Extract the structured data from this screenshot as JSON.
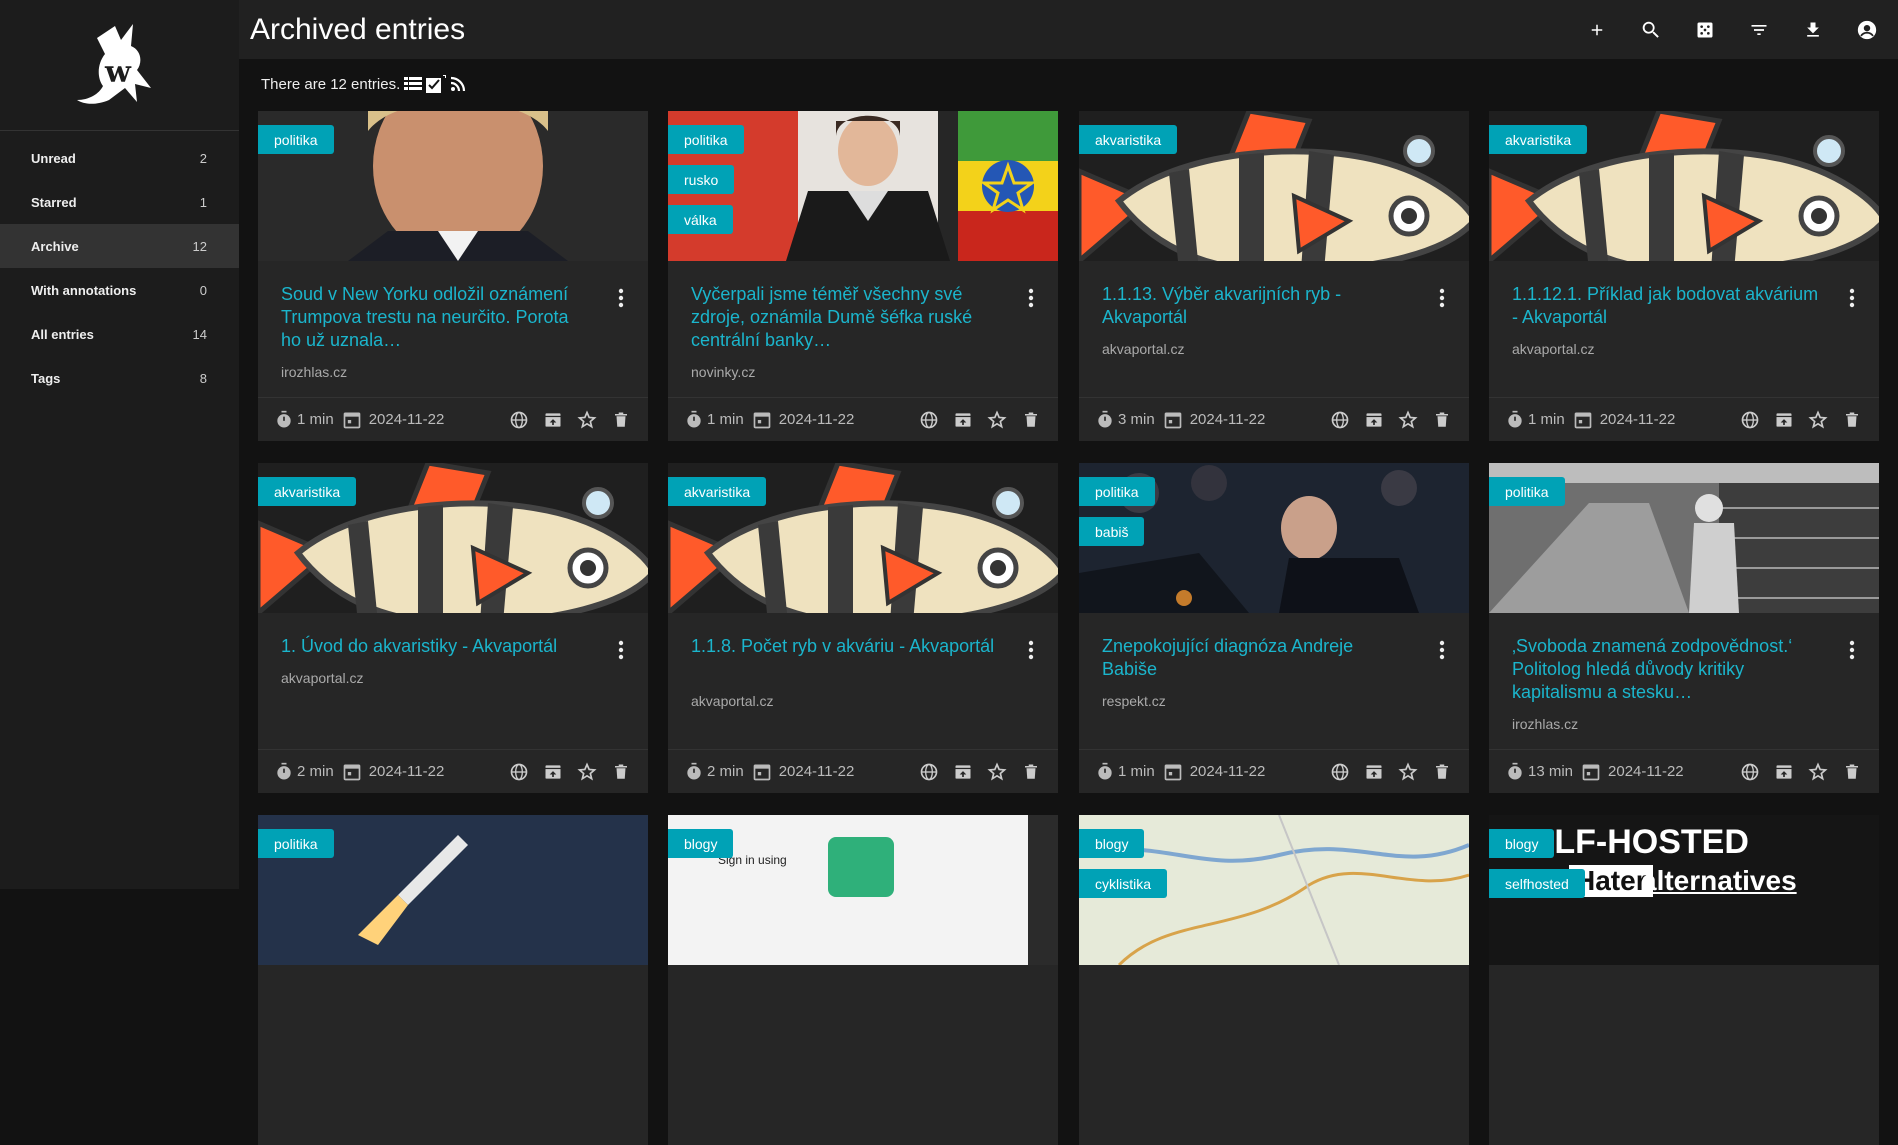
{
  "page": {
    "title": "Archived entries",
    "entries_text": "There are 12 entries."
  },
  "sidebar": {
    "items": [
      {
        "label": "Unread",
        "count": "2"
      },
      {
        "label": "Starred",
        "count": "1"
      },
      {
        "label": "Archive",
        "count": "12"
      },
      {
        "label": "With annotations",
        "count": "0"
      },
      {
        "label": "All entries",
        "count": "14"
      },
      {
        "label": "Tags",
        "count": "8"
      }
    ]
  },
  "toolbar": {
    "icons": [
      "plus-icon",
      "search-icon",
      "dice-icon",
      "filter-icon",
      "download-icon",
      "account-icon"
    ]
  },
  "cards": [
    {
      "tags": [
        "politika"
      ],
      "title": "Soud v New Yorku odložil oznámení Trumpova trestu na neurčito. Porota ho už uznala…",
      "domain": "irozhlas.cz",
      "time": "1 min",
      "date": "2024-11-22"
    },
    {
      "tags": [
        "politika",
        "rusko",
        "válka"
      ],
      "title": "Vyčerpali jsme téměř všechny své zdroje, oznámila Dumě šéfka ruské centrální banky…",
      "domain": "novinky.cz",
      "time": "1 min",
      "date": "2024-11-22"
    },
    {
      "tags": [
        "akvaristika"
      ],
      "title": "1.1.13. Výběr akvarijních ryb - Akvaportál",
      "domain": "akvaportal.cz",
      "time": "3 min",
      "date": "2024-11-22"
    },
    {
      "tags": [
        "akvaristika"
      ],
      "title": "1.1.12.1. Příklad jak bodovat akvárium - Akvaportál",
      "domain": "akvaportal.cz",
      "time": "1 min",
      "date": "2024-11-22"
    },
    {
      "tags": [
        "akvaristika"
      ],
      "title": "1. Úvod do akvaristiky - Akvaportál",
      "domain": "akvaportal.cz",
      "time": "2 min",
      "date": "2024-11-22"
    },
    {
      "tags": [
        "akvaristika"
      ],
      "title": "1.1.8. Počet ryb v akváriu - Akvaportál",
      "domain": "akvaportal.cz",
      "time": "2 min",
      "date": "2024-11-22"
    },
    {
      "tags": [
        "politika",
        "babiš"
      ],
      "title": "Znepokojující diagnóza Andreje Babiše",
      "domain": "respekt.cz",
      "time": "1 min",
      "date": "2024-11-22"
    },
    {
      "tags": [
        "politika"
      ],
      "title": "‚Svoboda znamená zodpovědnost.‘ Politolog hledá důvody kritiky kapitalismu a stesku…",
      "domain": "irozhlas.cz",
      "time": "13 min",
      "date": "2024-11-22"
    },
    {
      "tags": [
        "politika"
      ]
    },
    {
      "tags": [
        "blogy"
      ],
      "img_text": "Sign in using"
    },
    {
      "tags": [
        "blogy",
        "cyklistika"
      ]
    },
    {
      "tags": [
        "blogy",
        "selfhosted"
      ],
      "img_text_1": "SELF-HOSTED",
      "img_text_2": "Hater",
      "img_text_3": "alternatives"
    }
  ]
}
